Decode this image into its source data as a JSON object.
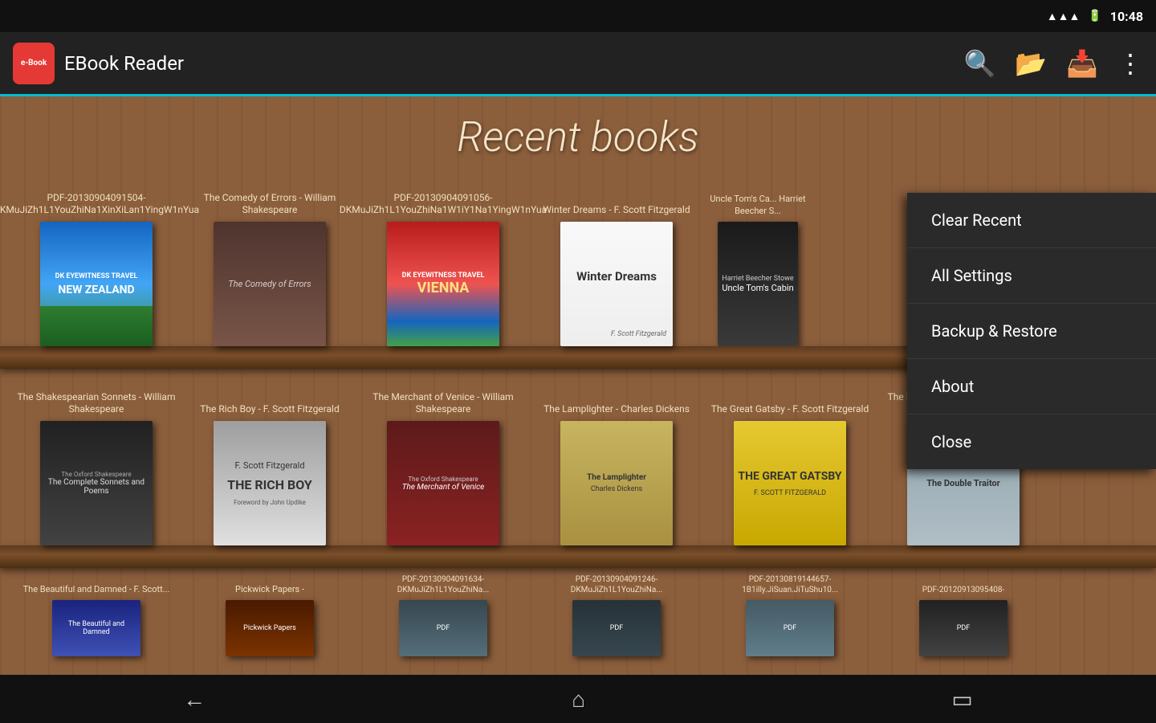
{
  "statusBar": {
    "time": "10:48",
    "wifiIcon": "📶",
    "batteryIcon": "🔋"
  },
  "topBar": {
    "appName": "EBook Reader",
    "logoText": "e-Book",
    "searchIcon": "🔍",
    "folderIcon": "📂",
    "downloadIcon": "📥",
    "moreIcon": "⋮"
  },
  "pageTitle": "Recent books",
  "menu": {
    "items": [
      {
        "label": "Clear Recent"
      },
      {
        "label": "All Settings"
      },
      {
        "label": "Backup & Restore"
      },
      {
        "label": "About"
      },
      {
        "label": "Close"
      }
    ]
  },
  "shelfRow1": {
    "books": [
      {
        "title": "PDF-20130904091504-DKMuJiZh1L1YouZhiNa1XinXiLan1YingW1nYua",
        "coverClass": "book-nz",
        "coverText": "NEW ZEALAND"
      },
      {
        "title": "The Comedy of Errors - William Shakespeare",
        "coverClass": "book-shakespeare",
        "coverText": "The Comedy of Errors"
      },
      {
        "title": "PDF-20130904091056-DKMuJiZh1L1YouZhiNa1W1iY1Na1YingW1nYua",
        "coverClass": "book-vienna",
        "coverText": "VIENNA"
      },
      {
        "title": "Winter Dreams - F. Scott Fitzgerald",
        "coverClass": "book-winter",
        "coverText": "Winter Dreams"
      },
      {
        "title": "Uncle Tom's Cabin - Harriet Beecher S.",
        "coverClass": "book-uncle",
        "coverText": "Uncle Tom's Cabin"
      }
    ]
  },
  "shelfRow2": {
    "books": [
      {
        "title": "The Shakespearian Sonnets - William Shakespeare",
        "coverClass": "book-sonnets",
        "coverText": "Sonnets"
      },
      {
        "title": "The Rich Boy - F. Scott Fitzgerald",
        "coverClass": "book-rich",
        "coverText": "THE RICH BOY"
      },
      {
        "title": "The Merchant of Venice - William Shakespeare",
        "coverClass": "book-venice",
        "coverText": "The Merchant of Venice"
      },
      {
        "title": "The Lamplighter - Charles Dickens",
        "coverClass": "book-lamplighter",
        "coverText": "The Lamplighter"
      },
      {
        "title": "The Great Gatsby - F. Scott Fitzgerald",
        "coverClass": "book-gatsby",
        "coverText": "THE GREAT GATSBY"
      },
      {
        "title": "The Double Traitor - Edward Phillips Oppenheim",
        "coverClass": "book-traitor",
        "coverText": "The Double Traitor"
      }
    ]
  },
  "shelfRow3": {
    "books": [
      {
        "title": "The Beautiful and Damned - F. Scott...",
        "coverClass": "book-beautiful",
        "coverText": "The Beautiful and Damned"
      },
      {
        "title": "Pickwick Papers -",
        "coverClass": "book-pickwick",
        "coverText": "Pickwick Papers"
      },
      {
        "title": "PDF-20130904091634-DKMuJiZh1L1YouZhiNa...",
        "coverClass": "book-pdf1",
        "coverText": "PDF"
      },
      {
        "title": "PDF-20130904091246-DKMuJiZh1L1YouZhiNa...",
        "coverClass": "book-pdf2",
        "coverText": "PDF"
      },
      {
        "title": "PDF-20130819144657-1B1illy.JiSuan.JiTuShu10...",
        "coverClass": "book-pdf3",
        "coverText": "PDF"
      },
      {
        "title": "PDF-20120913095408-",
        "coverClass": "book-pdf4",
        "coverText": "PDF"
      }
    ]
  },
  "bottomNav": {
    "backIcon": "←",
    "homeIcon": "⌂",
    "recentIcon": "▭"
  }
}
